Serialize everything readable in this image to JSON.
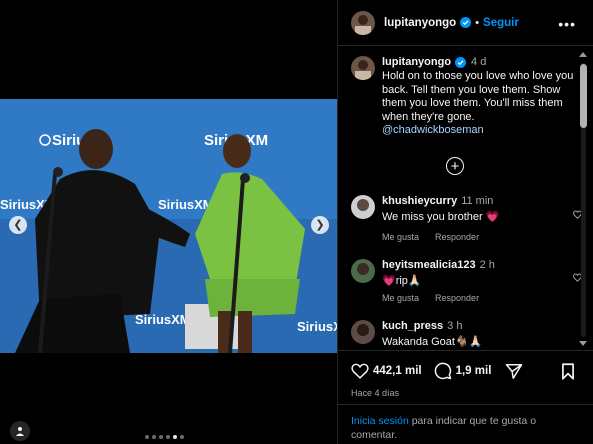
{
  "post": {
    "username": "lupitanyongo",
    "follow_label": "Seguir",
    "separator": "•",
    "more_label": "•••",
    "caption": {
      "username": "lupitanyongo",
      "time": "4 d",
      "text": "Hold on to those you love who love you back. Tell them you love them. Show them you love them. You'll miss them when they're gone.",
      "mention": "@chadwickboseman"
    },
    "load_more_label": "+"
  },
  "comments": [
    {
      "username": "khushieycurry",
      "time": "11 min",
      "text": "We miss you brother 💗",
      "like_label": "Me gusta",
      "reply_label": "Responder"
    },
    {
      "username": "heyitsmealicia123",
      "time": "2 h",
      "text": "💗rip🙏🏻",
      "like_label": "Me gusta",
      "reply_label": "Responder"
    },
    {
      "username": "kuch_press",
      "time": "3 h",
      "text": "Wakanda Goat🐐🙏🏻",
      "like_label": "",
      "reply_label": ""
    }
  ],
  "actions": {
    "likes": "442,1 mil",
    "comments": "1,9 mil",
    "date": "Hace 4 días"
  },
  "login": {
    "link": "Inicia sesión",
    "text": " para indicar que te gusta o comentar."
  },
  "carousel": {
    "total_slides": 6,
    "active_slide": 5
  },
  "photo": {
    "brand_texts": [
      "Sirius",
      "SiriusXM",
      "SiriusXM",
      "SiriusXM",
      "SiriusXM",
      "SiriusXM"
    ]
  },
  "colors": {
    "background": "#000000",
    "link_blue": "#0095f6",
    "muted": "#a8a8a8",
    "divider": "#262626",
    "photo_backdrop": "#2b6fb8"
  }
}
